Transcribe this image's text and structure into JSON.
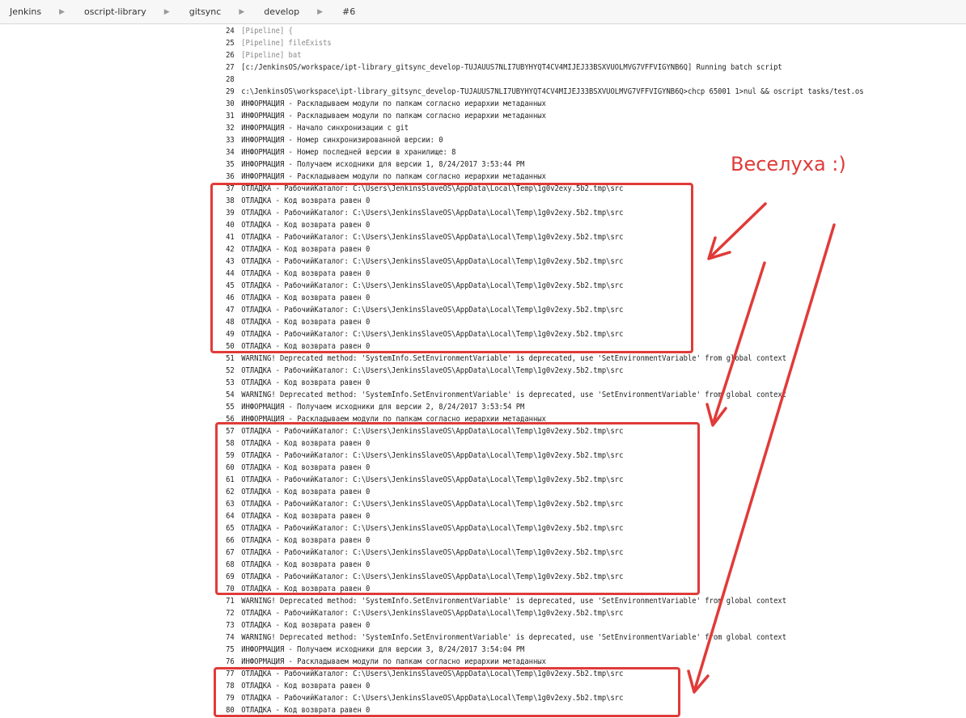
{
  "breadcrumb": [
    "Jenkins",
    "oscript-library",
    "gitsync",
    "develop",
    "#6"
  ],
  "annotation": {
    "text": "Веселуха :)",
    "color": "#e03b38"
  },
  "console": {
    "lines": [
      {
        "n": "24",
        "t": "[Pipeline] {",
        "pipe": true
      },
      {
        "n": "25",
        "t": "[Pipeline] fileExists",
        "pipe": true
      },
      {
        "n": "26",
        "t": "[Pipeline] bat",
        "pipe": true
      },
      {
        "n": "27",
        "t": "[c:/JenkinsOS/workspace/ipt-library_gitsync_develop-TUJAUUS7NLI7UBYHYQT4CV4MIJEJ33BSXVUOLMVG7VFFVIGYNB6Q] Running batch script"
      },
      {
        "n": "28",
        "t": ""
      },
      {
        "n": "29",
        "t": "c:\\JenkinsOS\\workspace\\ipt-library_gitsync_develop-TUJAUUS7NLI7UBYHYQT4CV4MIJEJ33BSXVUOLMVG7VFFVIGYNB6Q>chcp 65001 1>nul && oscript tasks/test.os"
      },
      {
        "n": "30",
        "t": "ИНФОРМАЦИЯ - Раскладываем модули по папкам согласно иерархии метаданных"
      },
      {
        "n": "31",
        "t": "ИНФОРМАЦИЯ - Раскладываем модули по папкам согласно иерархии метаданных"
      },
      {
        "n": "32",
        "t": "ИНФОРМАЦИЯ - Начало синхронизации с git"
      },
      {
        "n": "33",
        "t": "ИНФОРМАЦИЯ - Номер синхронизированной версии: 0"
      },
      {
        "n": "34",
        "t": "ИНФОРМАЦИЯ - Номер последней версии в хранилище: 8"
      },
      {
        "n": "35",
        "t": "ИНФОРМАЦИЯ - Получаем исходники для версии 1, 8/24/2017 3:53:44 PM"
      },
      {
        "n": "36",
        "t": "ИНФОРМАЦИЯ - Раскладываем модули по папкам согласно иерархии метаданных"
      },
      {
        "n": "37",
        "t": "ОТЛАДКА - РабочийКаталог: C:\\Users\\JenkinsSlaveOS\\AppData\\Local\\Temp\\1g0v2exy.5b2.tmp\\src"
      },
      {
        "n": "38",
        "t": "ОТЛАДКА - Код возврата равен 0"
      },
      {
        "n": "39",
        "t": "ОТЛАДКА - РабочийКаталог: C:\\Users\\JenkinsSlaveOS\\AppData\\Local\\Temp\\1g0v2exy.5b2.tmp\\src"
      },
      {
        "n": "40",
        "t": "ОТЛАДКА - Код возврата равен 0"
      },
      {
        "n": "41",
        "t": "ОТЛАДКА - РабочийКаталог: C:\\Users\\JenkinsSlaveOS\\AppData\\Local\\Temp\\1g0v2exy.5b2.tmp\\src"
      },
      {
        "n": "42",
        "t": "ОТЛАДКА - Код возврата равен 0"
      },
      {
        "n": "43",
        "t": "ОТЛАДКА - РабочийКаталог: C:\\Users\\JenkinsSlaveOS\\AppData\\Local\\Temp\\1g0v2exy.5b2.tmp\\src"
      },
      {
        "n": "44",
        "t": "ОТЛАДКА - Код возврата равен 0"
      },
      {
        "n": "45",
        "t": "ОТЛАДКА - РабочийКаталог: C:\\Users\\JenkinsSlaveOS\\AppData\\Local\\Temp\\1g0v2exy.5b2.tmp\\src"
      },
      {
        "n": "46",
        "t": "ОТЛАДКА - Код возврата равен 0"
      },
      {
        "n": "47",
        "t": "ОТЛАДКА - РабочийКаталог: C:\\Users\\JenkinsSlaveOS\\AppData\\Local\\Temp\\1g0v2exy.5b2.tmp\\src"
      },
      {
        "n": "48",
        "t": "ОТЛАДКА - Код возврата равен 0"
      },
      {
        "n": "49",
        "t": "ОТЛАДКА - РабочийКаталог: C:\\Users\\JenkinsSlaveOS\\AppData\\Local\\Temp\\1g0v2exy.5b2.tmp\\src"
      },
      {
        "n": "50",
        "t": "ОТЛАДКА - Код возврата равен 0"
      },
      {
        "n": "51",
        "t": "WARNING! Deprecated method: 'SystemInfo.SetEnvironmentVariable' is deprecated, use 'SetEnvironmentVariable' from global context"
      },
      {
        "n": "52",
        "t": "ОТЛАДКА - РабочийКаталог: C:\\Users\\JenkinsSlaveOS\\AppData\\Local\\Temp\\1g0v2exy.5b2.tmp\\src"
      },
      {
        "n": "53",
        "t": "ОТЛАДКА - Код возврата равен 0"
      },
      {
        "n": "54",
        "t": "WARNING! Deprecated method: 'SystemInfo.SetEnvironmentVariable' is deprecated, use 'SetEnvironmentVariable' from global context"
      },
      {
        "n": "55",
        "t": "ИНФОРМАЦИЯ - Получаем исходники для версии 2, 8/24/2017 3:53:54 PM"
      },
      {
        "n": "56",
        "t": "ИНФОРМАЦИЯ - Раскладываем модули по папкам согласно иерархии метаданных"
      },
      {
        "n": "57",
        "t": "ОТЛАДКА - РабочийКаталог: C:\\Users\\JenkinsSlaveOS\\AppData\\Local\\Temp\\1g0v2exy.5b2.tmp\\src"
      },
      {
        "n": "58",
        "t": "ОТЛАДКА - Код возврата равен 0"
      },
      {
        "n": "59",
        "t": "ОТЛАДКА - РабочийКаталог: C:\\Users\\JenkinsSlaveOS\\AppData\\Local\\Temp\\1g0v2exy.5b2.tmp\\src"
      },
      {
        "n": "60",
        "t": "ОТЛАДКА - Код возврата равен 0"
      },
      {
        "n": "61",
        "t": "ОТЛАДКА - РабочийКаталог: C:\\Users\\JenkinsSlaveOS\\AppData\\Local\\Temp\\1g0v2exy.5b2.tmp\\src"
      },
      {
        "n": "62",
        "t": "ОТЛАДКА - Код возврата равен 0"
      },
      {
        "n": "63",
        "t": "ОТЛАДКА - РабочийКаталог: C:\\Users\\JenkinsSlaveOS\\AppData\\Local\\Temp\\1g0v2exy.5b2.tmp\\src"
      },
      {
        "n": "64",
        "t": "ОТЛАДКА - Код возврата равен 0"
      },
      {
        "n": "65",
        "t": "ОТЛАДКА - РабочийКаталог: C:\\Users\\JenkinsSlaveOS\\AppData\\Local\\Temp\\1g0v2exy.5b2.tmp\\src"
      },
      {
        "n": "66",
        "t": "ОТЛАДКА - Код возврата равен 0"
      },
      {
        "n": "67",
        "t": "ОТЛАДКА - РабочийКаталог: C:\\Users\\JenkinsSlaveOS\\AppData\\Local\\Temp\\1g0v2exy.5b2.tmp\\src"
      },
      {
        "n": "68",
        "t": "ОТЛАДКА - Код возврата равен 0"
      },
      {
        "n": "69",
        "t": "ОТЛАДКА - РабочийКаталог: C:\\Users\\JenkinsSlaveOS\\AppData\\Local\\Temp\\1g0v2exy.5b2.tmp\\src"
      },
      {
        "n": "70",
        "t": "ОТЛАДКА - Код возврата равен 0"
      },
      {
        "n": "71",
        "t": "WARNING! Deprecated method: 'SystemInfo.SetEnvironmentVariable' is deprecated, use 'SetEnvironmentVariable' from global context"
      },
      {
        "n": "72",
        "t": "ОТЛАДКА - РабочийКаталог: C:\\Users\\JenkinsSlaveOS\\AppData\\Local\\Temp\\1g0v2exy.5b2.tmp\\src"
      },
      {
        "n": "73",
        "t": "ОТЛАДКА - Код возврата равен 0"
      },
      {
        "n": "74",
        "t": "WARNING! Deprecated method: 'SystemInfo.SetEnvironmentVariable' is deprecated, use 'SetEnvironmentVariable' from global context"
      },
      {
        "n": "75",
        "t": "ИНФОРМАЦИЯ - Получаем исходники для версии 3, 8/24/2017 3:54:04 PM"
      },
      {
        "n": "76",
        "t": "ИНФОРМАЦИЯ - Раскладываем модули по папкам согласно иерархии метаданных"
      },
      {
        "n": "77",
        "t": "ОТЛАДКА - РабочийКаталог: C:\\Users\\JenkinsSlaveOS\\AppData\\Local\\Temp\\1g0v2exy.5b2.tmp\\src"
      },
      {
        "n": "78",
        "t": "ОТЛАДКА - Код возврата равен 0"
      },
      {
        "n": "79",
        "t": "ОТЛАДКА - РабочийКаталог: C:\\Users\\JenkinsSlaveOS\\AppData\\Local\\Temp\\1g0v2exy.5b2.tmp\\src"
      },
      {
        "n": "80",
        "t": "ОТЛАДКА - Код возврата равен 0"
      }
    ]
  }
}
